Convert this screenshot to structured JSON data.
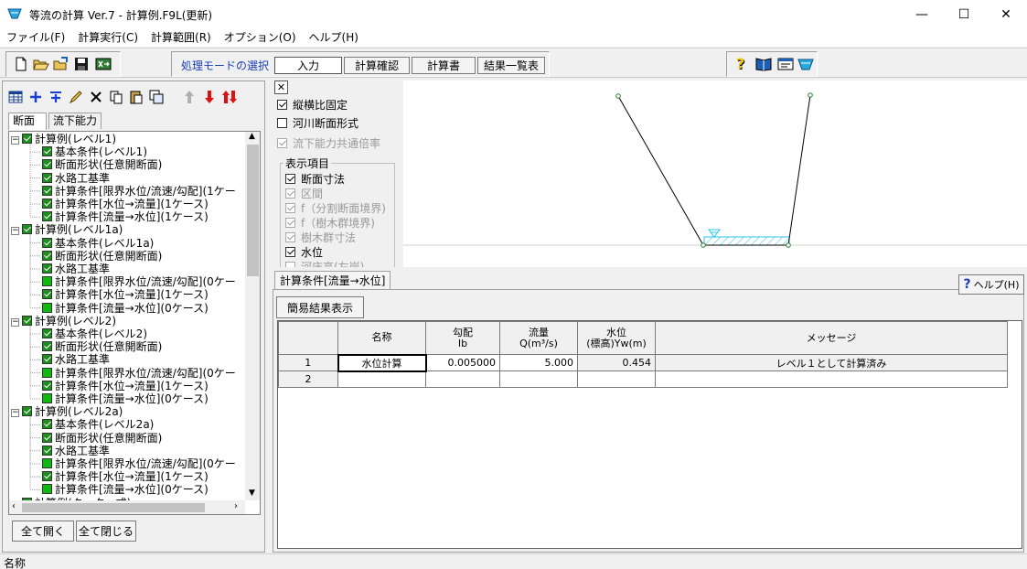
{
  "window": {
    "title": "等流の計算 Ver.7 - 計算例.F9L(更新)",
    "minimize_glyph": "—",
    "maximize_glyph": "☐",
    "close_glyph": "✕"
  },
  "menu": [
    "ファイル(F)",
    "計算実行(C)",
    "計算範囲(R)",
    "オプション(O)",
    "ヘルプ(H)"
  ],
  "toolbar": {
    "mode_label": "処理モードの選択",
    "modes": [
      "入力",
      "計算確認",
      "計算書",
      "結果一覧表"
    ],
    "file_icons": [
      "new-file-icon",
      "open-folder-icon",
      "import-folder-icon",
      "save-disk-icon",
      "export-icon"
    ],
    "help_icons": [
      "help-question-icon",
      "manual-book-icon",
      "version-info-icon",
      "app-icon"
    ]
  },
  "left": {
    "tabs": [
      "断面",
      "流下能力"
    ],
    "tree": [
      {
        "level": 0,
        "label": "計算例(レベル1)"
      },
      {
        "level": 1,
        "label": "基本条件(レベル1)"
      },
      {
        "level": 1,
        "label": "断面形状(任意開断面)"
      },
      {
        "level": 1,
        "label": "水路工基準"
      },
      {
        "level": 1,
        "label": "計算条件[限界水位/流速/勾配](1ケー"
      },
      {
        "level": 1,
        "label": "計算条件[水位→流量](1ケース)"
      },
      {
        "level": 1,
        "label": "計算条件[流量→水位](1ケース)"
      },
      {
        "level": 0,
        "label": "計算例(レベル1a)"
      },
      {
        "level": 1,
        "label": "基本条件(レベル1a)"
      },
      {
        "level": 1,
        "label": "断面形状(任意開断面)"
      },
      {
        "level": 1,
        "label": "水路工基準"
      },
      {
        "level": 1,
        "label": "計算条件[限界水位/流速/勾配](0ケー",
        "empty": true
      },
      {
        "level": 1,
        "label": "計算条件[水位→流量](1ケース)"
      },
      {
        "level": 1,
        "label": "計算条件[流量→水位](0ケース)",
        "empty": true
      },
      {
        "level": 0,
        "label": "計算例(レベル2)"
      },
      {
        "level": 1,
        "label": "基本条件(レベル2)"
      },
      {
        "level": 1,
        "label": "断面形状(任意開断面)"
      },
      {
        "level": 1,
        "label": "水路工基準"
      },
      {
        "level": 1,
        "label": "計算条件[限界水位/流速/勾配](0ケー",
        "empty": true
      },
      {
        "level": 1,
        "label": "計算条件[水位→流量](1ケース)"
      },
      {
        "level": 1,
        "label": "計算条件[流量→水位](0ケース)",
        "empty": true
      },
      {
        "level": 0,
        "label": "計算例(レベル2a)"
      },
      {
        "level": 1,
        "label": "基本条件(レベル2a)"
      },
      {
        "level": 1,
        "label": "断面形状(任意開断面)"
      },
      {
        "level": 1,
        "label": "水路工基準"
      },
      {
        "level": 1,
        "label": "計算条件[限界水位/流速/勾配](0ケー",
        "empty": true
      },
      {
        "level": 1,
        "label": "計算条件[水位→流量](1ケース)"
      },
      {
        "level": 1,
        "label": "計算条件[流量→水位](0ケース)",
        "empty": true
      },
      {
        "level": 0,
        "label": "計算例(クッター式)"
      }
    ],
    "expand_all": "全て開く",
    "collapse_all": "全て閉じる"
  },
  "options": {
    "close_glyph": "✕",
    "fixed_aspect": "縦横比固定",
    "river_section": "河川断面形式",
    "common_factor": "流下能力共通倍率",
    "display_group": "表示項目",
    "items": [
      {
        "label": "断面寸法",
        "checked": true,
        "disabled": false
      },
      {
        "label": "区間",
        "checked": true,
        "disabled": true
      },
      {
        "label": "f（分割断面境界)",
        "checked": true,
        "disabled": true
      },
      {
        "label": "f（樹木群境界)",
        "checked": true,
        "disabled": true
      },
      {
        "label": "樹木群寸法",
        "checked": true,
        "disabled": true
      },
      {
        "label": "水位",
        "checked": true,
        "disabled": false
      },
      {
        "label": "河床高(左岸)",
        "checked": false,
        "disabled": true
      }
    ]
  },
  "lower": {
    "tab": "計算条件[流量→水位]",
    "help": "ヘルプ(H)",
    "simple_result": "簡易結果表示",
    "headers": [
      "名称",
      "勾配\nIb",
      "流量\nQ(m³/s)",
      "水位\n(標高)Yw(m)",
      "メッセージ"
    ],
    "rows": [
      {
        "no": "1",
        "name": "水位計算",
        "slope": "0.005000",
        "flow": "5.000",
        "level": "0.454",
        "message": "レベル１として計算済み"
      },
      {
        "no": "2",
        "name": "",
        "slope": "",
        "flow": "",
        "level": "",
        "message": ""
      }
    ]
  },
  "status": {
    "text": "名称"
  },
  "colors": {
    "accent": "#1a5fb4",
    "water": "#29c5e6",
    "check_green": "#1e8f1e"
  }
}
